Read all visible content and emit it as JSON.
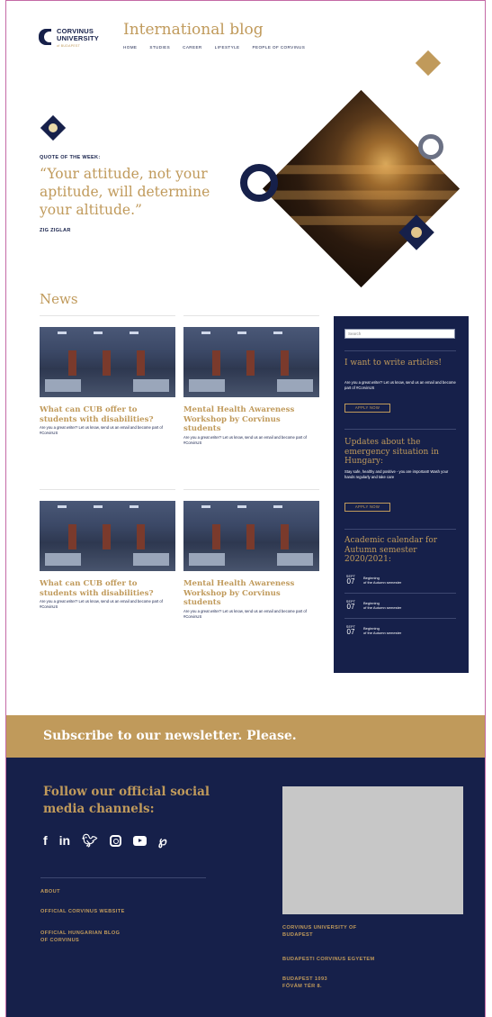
{
  "header": {
    "logo_text": "CORVINUS\nUNIVERSITY",
    "logo_sub": "of BUDAPEST",
    "blog_title": "International blog",
    "nav": [
      "HOME",
      "STUDIES",
      "CAREER",
      "LIFESTYLE",
      "PEOPLE OF CORVINUS"
    ]
  },
  "quote": {
    "label": "QUOTE OF THE WEEK:",
    "text": "“Your attitude, not your aptitude, will determine your altitude.”",
    "author": "ZIG ZIGLAR"
  },
  "news": {
    "title": "News",
    "cards": [
      {
        "title": "What can CUB offer to students with disabilities?",
        "text": "Are you a great writer? Let us know, send us an email and become part of #CorvinUS"
      },
      {
        "title": "Mental Health Awareness Workshop by Corvinus students",
        "text": "Are you a great writer? Let us know, send us an email and become part of #CorvinUS"
      },
      {
        "title": "What can CUB offer to students with disabilities?",
        "text": "Are you a great writer? Let us know, send us an email and become part of #CorvinUS"
      },
      {
        "title": "Mental Health Awareness Workshop by Corvinus students",
        "text": "Are you a great writer? Let us know, send us an email and become part of #CorvinUS"
      }
    ]
  },
  "sidebar": {
    "search_placeholder": "Search",
    "write": {
      "title": "I want to write articles!",
      "text": "Are you a great writer? Let us know, send us an email and become part of #CorvinUS",
      "button": "APPLY NOW"
    },
    "updates": {
      "title": "Updates about the emergency situation in Hungary:",
      "text": "Stay safe, healthy and positive - you are important! Wash your hands regularly and take care",
      "button": "APPLY NOW"
    },
    "calendar": {
      "title": "Academic calendar for Autumn semester 2020/2021:",
      "events": [
        {
          "month": "SEPT",
          "day": "07",
          "text": "Beginning\nof the Autumn semester"
        },
        {
          "month": "SEPT",
          "day": "07",
          "text": "Beginning\nof the Autumn semester"
        },
        {
          "month": "SEPT",
          "day": "07",
          "text": "Beginning\nof the Autumn semester"
        }
      ]
    }
  },
  "newsletter": {
    "text": "Subscribe to our newsletter. Please."
  },
  "footer": {
    "follow": "Follow our official social media channels:",
    "social_icons": [
      "facebook-icon",
      "linkedin-icon",
      "twitter-icon",
      "instagram-icon",
      "youtube-icon",
      "pinterest-icon"
    ],
    "links": [
      "ABOUT",
      "OFFICIAL CORVINUS WEBSITE",
      "OFFICIAL HUNGARIAN BLOG\nOF CORVINUS"
    ],
    "address": [
      "CORVINUS UNIVERSITY OF\nBUDAPEST",
      "BUDAPESTI CORVINUS EGYETEM",
      "BUDAPEST 1093\nFŐVÁM TÉR 8."
    ]
  },
  "colors": {
    "navy": "#16204a",
    "gold": "#c09a5b",
    "white": "#ffffff",
    "map_placeholder": "#c7c7c7"
  }
}
